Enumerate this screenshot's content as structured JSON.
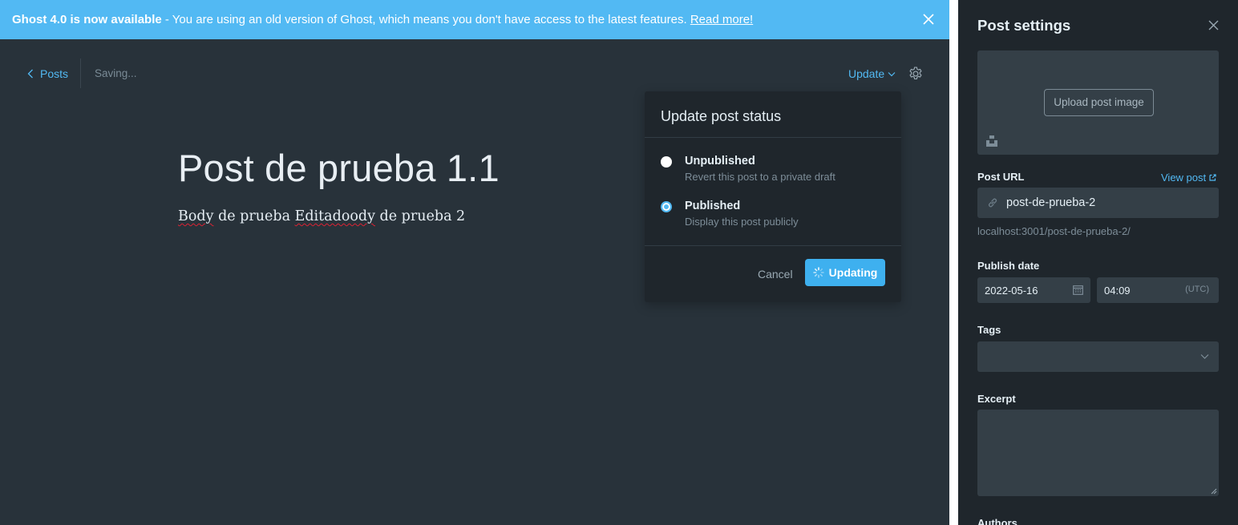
{
  "banner": {
    "bold": "Ghost 4.0 is now available",
    "text": " - You are using an old version of Ghost, which means you don't have access to the latest features. ",
    "link": "Read more!"
  },
  "editor": {
    "back_label": "Posts",
    "status": "Saving...",
    "update_label": "Update",
    "title": "Post de prueba 1.1",
    "body": {
      "w1": "Body",
      "t1": " de prueba ",
      "w2": "Editadoody",
      "t2": " de prueba 2"
    }
  },
  "popup": {
    "heading": "Update post status",
    "options": [
      {
        "title": "Unpublished",
        "description": "Revert this post to a private draft",
        "selected": false
      },
      {
        "title": "Published",
        "description": "Display this post publicly",
        "selected": true
      }
    ],
    "cancel": "Cancel",
    "confirm": "Updating"
  },
  "settings": {
    "title": "Post settings",
    "upload_label": "Upload post image",
    "url_label": "Post URL",
    "view_post": "View post",
    "slug": "post-de-prueba-2",
    "url_hint": "localhost:3001/post-de-prueba-2/",
    "publish_label": "Publish date",
    "date": "2022-05-16",
    "time": "04:09",
    "timezone": "(UTC)",
    "tags_label": "Tags",
    "excerpt_label": "Excerpt",
    "authors_label": "Authors"
  },
  "colors": {
    "accent": "#52b9f3",
    "editor_bg": "#28323a",
    "panel_bg": "#1f262c",
    "field_bg": "#343f47"
  }
}
